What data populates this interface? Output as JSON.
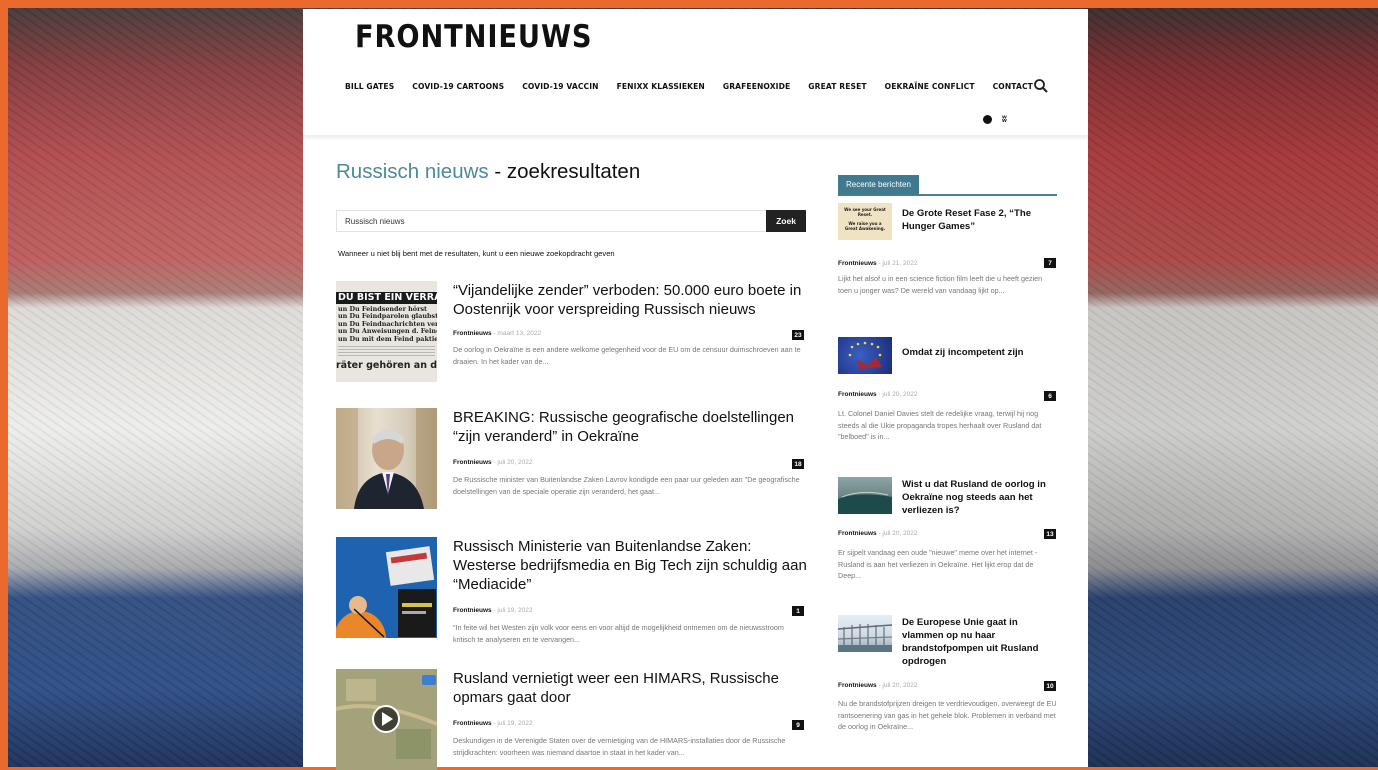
{
  "site": {
    "logo": "FRONTNIEUWS",
    "nav": [
      "BILL GATES",
      "COVID-19 CARTOONS",
      "COVID-19 VACCIN",
      "FENIXX KLASSIEKEN",
      "GRAFEENOXIDE",
      "GREAT RESET",
      "OEKRAÏNE CONFLICT",
      "CONTACT"
    ]
  },
  "search": {
    "title_query": "Russisch nieuws",
    "title_suffix": " - zoekresultaten",
    "value": "Russisch nieuws",
    "button": "Zoek",
    "hint": "Wanneer u niet blij bent met de resultaten, kunt u een nieuwe zoekopdracht geven"
  },
  "posts": [
    {
      "title": "“Vijandelijke zender” verboden: 50.000 euro boete in Oostenrijk voor verspreiding Russisch nieuws",
      "author": "Frontnieuws",
      "date": "maart 13, 2022",
      "comments": "23",
      "excerpt": "De oorlog in Oekraïne is een andere welkome gelegenheid voor de EU om de censuur duimschroeven aan te draaien. In het kader van de...",
      "thumb_text": [
        "DU BIST EIN VERRÄTER!",
        "un Du Feindsender hörst",
        "un Du Feindparolen glaubst",
        "un Du Feindnachrichten verbreitest",
        "un Du Anweisungen d. Feindes befolgst",
        "un Du mit dem Feind paktierst",
        "räter gehören an den Galgen"
      ]
    },
    {
      "title": "BREAKING: Russische geografische doelstellingen “zijn veranderd” in Oekraïne",
      "author": "Frontnieuws",
      "date": "juli 20, 2022",
      "comments": "18",
      "excerpt": "De Russische minister van Buitenlandse Zaken Lavrov kondigde een paar uur geleden aan \"De geografische doelstellingen van de speciale operatie zijn veranderd, het gaat..."
    },
    {
      "title": "Russisch Ministerie van Buitenlandse Zaken: Westerse bedrijfsmedia en Big Tech zijn schuldig aan “Mediacide”",
      "author": "Frontnieuws",
      "date": "juli 19, 2022",
      "comments": "1",
      "excerpt": "\"In feite wil het Westen zijn volk voor eens en voor altijd de mogelijkheid ontnemen om de nieuwsstroom kritisch te analyseren en te vervangen..."
    },
    {
      "title": "Rusland vernietigt weer een HIMARS, Russische opmars gaat door",
      "author": "Frontnieuws",
      "date": "juli 19, 2022",
      "comments": "9",
      "excerpt": "Deskundigen in de Verenigde Staten over de vernietiging van de HIMARS-installaties door de Russische strijdkrachten: voorheen was niemand daartoe in staat in het kader van..."
    }
  ],
  "sidebar": {
    "heading": "Recente berichten",
    "posts": [
      {
        "title": "De Grote Reset Fase 2, “The Hunger Games”",
        "author": "Frontnieuws",
        "date": "juli 21, 2022",
        "comments": "7",
        "excerpt": "Lijkt het alsof u in een science fiction film leeft die u heeft gezien toen u jonger was? De wereld van vandaag lijkt op...",
        "thumb_text": [
          "We see your Great Reset.",
          "We raise you a Great Awakening."
        ]
      },
      {
        "title": "Omdat zij incompetent zijn",
        "author": "Frontnieuws",
        "date": "juli 20, 2022",
        "comments": "6",
        "excerpt": "Lt. Colonel Daniel Davies stelt de redelijke vraag, terwijl hij nog steeds al die Ukie propaganda tropes herhaalt over Rusland dat \"belboed\" is in..."
      },
      {
        "title": "Wist u dat Rusland de oorlog in Oekraïne nog steeds aan het verliezen is?",
        "author": "Frontnieuws",
        "date": "juli 20, 2022",
        "comments": "13",
        "excerpt": "Er sijpelt vandaag een oude \"nieuwe\" meme over het internet - Rusland is aan het verliezen in Oekraïne. Het lijkt erop dat de Deep..."
      },
      {
        "title": "De Europese Unie gaat in vlammen op nu haar brandstofpompen uit Rusland opdrogen",
        "author": "Frontnieuws",
        "date": "juli 20, 2022",
        "comments": "10",
        "excerpt": "Nu de brandstofprijzen dreigen te verdrievoudigen, overweegt de EU rantsoenering van gas in het gehele blok. Problemen in verband met de oorlog in Oekraïne..."
      }
    ]
  }
}
